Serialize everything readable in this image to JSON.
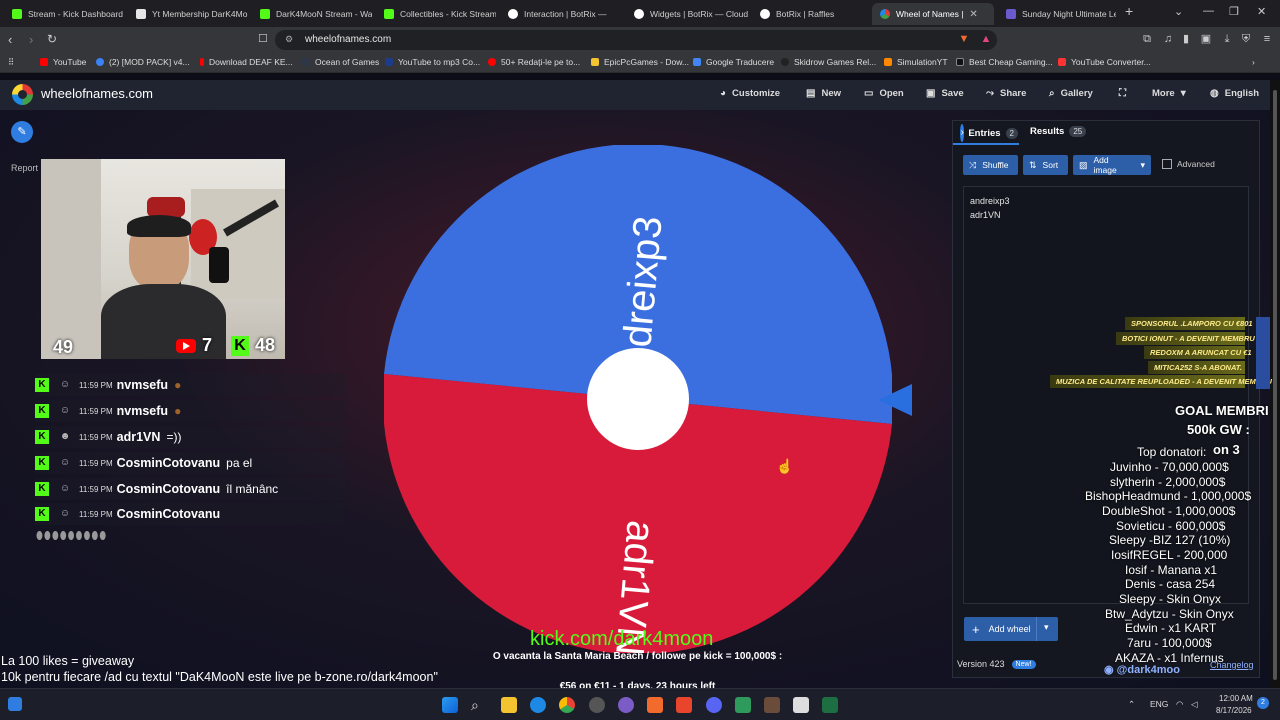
{
  "browser": {
    "tabs": [
      {
        "title": "Stream - Kick Dashboard",
        "color": "#53fc18"
      },
      {
        "title": "Yt Membership DarK4Mo",
        "color": "#e6e6e6"
      },
      {
        "title": "DarK4MooN Stream - Wa",
        "color": "#53fc18"
      },
      {
        "title": "Collectibles - Kick Stream",
        "color": "#53fc18"
      },
      {
        "title": "Interaction | BotRix —",
        "color": "#ffffff"
      },
      {
        "title": "Widgets | BotRix — Cloud",
        "color": "#ffffff"
      },
      {
        "title": "BotRix | Raffles",
        "color": "#ffffff"
      },
      {
        "title": "Wheel of Names |",
        "color": "#e53935"
      },
      {
        "title": "Sunday Night Ultimate Le",
        "color": "#6a5acd"
      }
    ],
    "new_tab": "+",
    "url": "wheelofnames.com",
    "bookmarks": [
      {
        "label": "YouTube",
        "color": "#ff0000"
      },
      {
        "label": "(2) [MOD PACK] v4...",
        "color": "#3b82f6"
      },
      {
        "label": "Download DEAF KE...",
        "color": "#ff0000"
      },
      {
        "label": "Ocean of Games",
        "color": "#2d3748"
      },
      {
        "label": "YouTube to mp3 Co...",
        "color": "#1e3a8a"
      },
      {
        "label": "50+ Redați-le pe to...",
        "color": "#ff0000"
      },
      {
        "label": "EpicPcGames - Dow...",
        "color": "#f4c430"
      },
      {
        "label": "Google Traducere",
        "color": "#4285f4"
      },
      {
        "label": "Skidrow Games Rel...",
        "color": "#222222"
      },
      {
        "label": "SimulationYT",
        "color": "#ff8800"
      },
      {
        "label": "Best Cheap Gaming...",
        "color": "#111111"
      },
      {
        "label": "YouTube Converter...",
        "color": "#ff3333"
      }
    ]
  },
  "site": {
    "logo": "wheelofnames.com",
    "menu": [
      "Customize",
      "New",
      "Open",
      "Save",
      "Share",
      "Gallery",
      "Fullscreen",
      "More",
      "English"
    ]
  },
  "stream": {
    "report": "Report",
    "viewers": "49",
    "youtube_count": "7",
    "kick_count": "48",
    "chat": [
      {
        "time": "11:59 PM",
        "name": "nvmsefu",
        "msg": ""
      },
      {
        "time": "11:59 PM",
        "name": "nvmsefu",
        "msg": ""
      },
      {
        "time": "11:59 PM",
        "name": "adr1VN",
        "msg": "=))"
      },
      {
        "time": "11:59 PM",
        "name": "CosminCotovanu",
        "msg": "pa el"
      },
      {
        "time": "11:59 PM",
        "name": "CosminCotovanu",
        "msg": "îl mănânc"
      },
      {
        "time": "11:59 PM",
        "name": "CosminCotovanu",
        "msg": ""
      }
    ],
    "bottom_line1": "La 100 likes = giveaway",
    "bottom_line2": "10k pentru fiecare /ad cu textul \"DaK4MooN este live pe b-zone.ro/dark4moon\"",
    "kick_link": "kick.com/dark4moon",
    "vacanta": "O vacanta la Santa Maria Beach / followe pe kick = 100,000$ :",
    "euro": "€56 on €11 - 1 days, 23 hours left",
    "banners": [
      "SPONSORUL .LAMPORO CU €801",
      "BOTICI IONUT - A DEVENIT MEMBRU",
      "REDOXM A ARUNCAT CU €1",
      "MITICA252 S-A ABONAT.",
      "MUZICA DE CALITATE REUPLOADED - A DEVENIT MEMBRU"
    ],
    "goal1": "GOAL MEMBRI",
    "goal2": "500k GW :",
    "goal3": "on 3",
    "top_title": "Top donatori:",
    "donors": [
      "Juvinho - 70,000,000$",
      "slytherin - 2,000,000$",
      "BishopHeadmund - 1,000,000$",
      "DoubleShot - 1,000,000$",
      "Sovieticu - 600,000$",
      "Sleepy -BIZ 127 (10%)",
      "IosifREGEL - 200,000",
      "Iosif - Manana x1",
      "Denis - casa 254",
      "Sleepy - Skin Onyx",
      "Btw_Adytzu - Skin Onyx",
      "Edwin - x1 KART",
      "7aru - 100,000$",
      "AKAZA - x1 Infernus"
    ],
    "discord": "@dark4moo"
  },
  "wheel": {
    "segments": [
      {
        "label": "andreixp3",
        "color": "#3b6fe0"
      },
      {
        "label": "adr1VN",
        "color": "#d81b3a"
      }
    ]
  },
  "panel": {
    "entries_label": "Entries",
    "entries_count": "2",
    "results_label": "Results",
    "results_count": "25",
    "shuffle": "Shuffle",
    "sort": "Sort",
    "add_image": "Add image",
    "advanced": "Advanced",
    "entries": [
      "andreixp3",
      "adr1VN"
    ],
    "add_wheel": "Add wheel",
    "version": "Version 423",
    "new_badge": "New!",
    "changelog": "Changelog"
  },
  "taskbar": {
    "lang": "ENG",
    "time": "12:00 AM",
    "date": "8/17/2026",
    "notif": "2"
  }
}
